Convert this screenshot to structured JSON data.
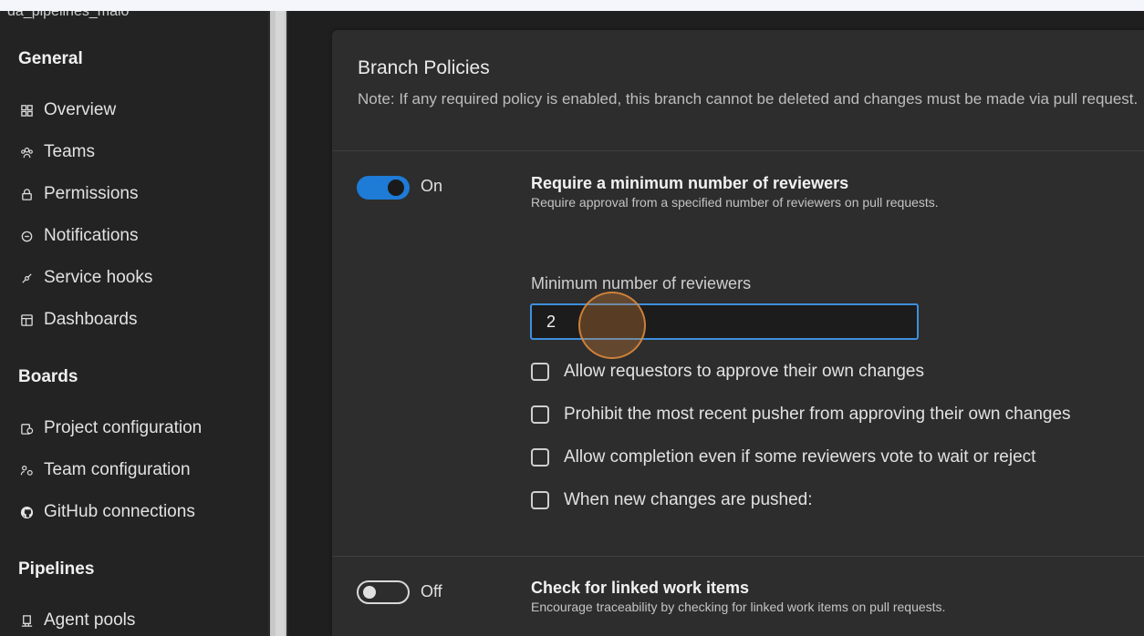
{
  "sidebar": {
    "project_name": "da_pipelines_malo",
    "sections": {
      "general": "General",
      "boards": "Boards",
      "pipelines": "Pipelines"
    },
    "general_items": [
      {
        "label": "Overview",
        "icon": "overview-icon"
      },
      {
        "label": "Teams",
        "icon": "teams-icon"
      },
      {
        "label": "Permissions",
        "icon": "lock-icon"
      },
      {
        "label": "Notifications",
        "icon": "notifications-icon"
      },
      {
        "label": "Service hooks",
        "icon": "service-hooks-icon"
      },
      {
        "label": "Dashboards",
        "icon": "dashboards-icon"
      }
    ],
    "boards_items": [
      {
        "label": "Project configuration",
        "icon": "project-configuration-icon"
      },
      {
        "label": "Team configuration",
        "icon": "team-configuration-icon"
      },
      {
        "label": "GitHub connections",
        "icon": "github-icon"
      }
    ],
    "pipelines_items": [
      {
        "label": "Agent pools",
        "icon": "agent-pools-icon"
      }
    ]
  },
  "panel": {
    "title": "Branch Policies",
    "note": "Note: If any required policy is enabled, this branch cannot be deleted and changes must be made via pull request."
  },
  "policies": [
    {
      "toggle_state": "On",
      "title": "Require a minimum number of reviewers",
      "description": "Require approval from a specified number of reviewers on pull requests.",
      "field_label": "Minimum number of reviewers",
      "field_value": "2",
      "options": [
        "Allow requestors to approve their own changes",
        "Prohibit the most recent pusher from approving their own changes",
        "Allow completion even if some reviewers vote to wait or reject",
        "When new changes are pushed:"
      ]
    },
    {
      "toggle_state": "Off",
      "title": "Check for linked work items",
      "description": "Encourage traceability by checking for linked work items on pull requests."
    }
  ],
  "colors": {
    "accent": "#1e7bd6",
    "focus_border": "#3e8fde",
    "click_highlight": "#d68234"
  }
}
